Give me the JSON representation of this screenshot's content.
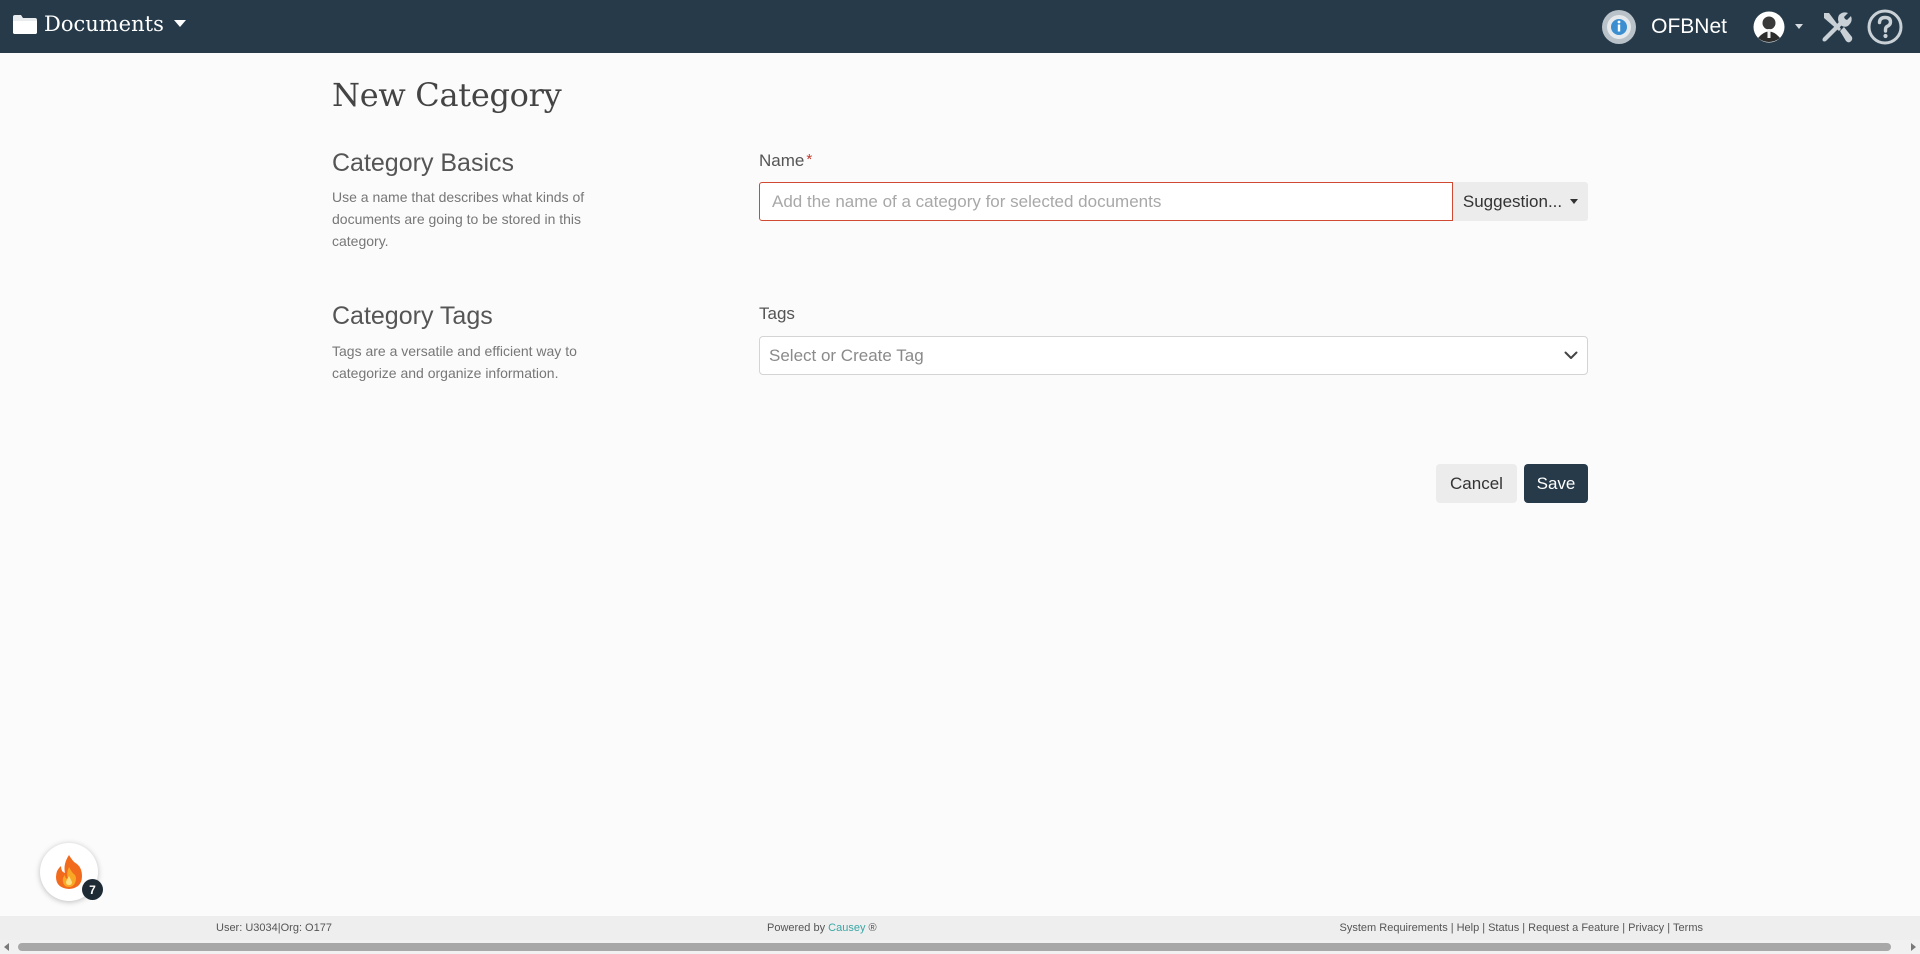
{
  "navbar": {
    "brand_label": "Documents",
    "org_name": "OFBNet"
  },
  "page": {
    "title": "New Category"
  },
  "basics": {
    "title": "Category Basics",
    "description": "Use a name that describes what kinds of documents are going to be stored in this category.",
    "name_label": "Name",
    "required_mark": "*",
    "name_placeholder": "Add the name of a category for selected documents",
    "suggestions_label": "Suggestion..."
  },
  "tags": {
    "title": "Category Tags",
    "description": "Tags are a versatile and efficient way to categorize and organize information.",
    "tags_label": "Tags",
    "select_placeholder": "Select or Create Tag"
  },
  "actions": {
    "cancel_label": "Cancel",
    "save_label": "Save"
  },
  "fab": {
    "count": "7"
  },
  "footer": {
    "user_info": "User: U3034|Org: O177",
    "powered_prefix": "Powered by",
    "powered_link": "Causey",
    "powered_suffix": "®",
    "links": {
      "system_requirements": "System Requirements",
      "help": "Help",
      "status": "Status",
      "request_feature": "Request a Feature",
      "privacy": "Privacy",
      "terms": "Terms"
    },
    "separator": "|"
  },
  "icons": {
    "brand": "folder-icon",
    "org": "info-badge-icon",
    "user": "user-avatar-icon",
    "tools": "tools-icon",
    "help": "help-circle-icon",
    "fab": "flame-icon"
  },
  "colors": {
    "navbar_bg": "#263a49",
    "save_bg": "#263a49",
    "invalid_border": "#d04a33",
    "required_star": "#c0392b",
    "link": "#3aa6a6"
  }
}
